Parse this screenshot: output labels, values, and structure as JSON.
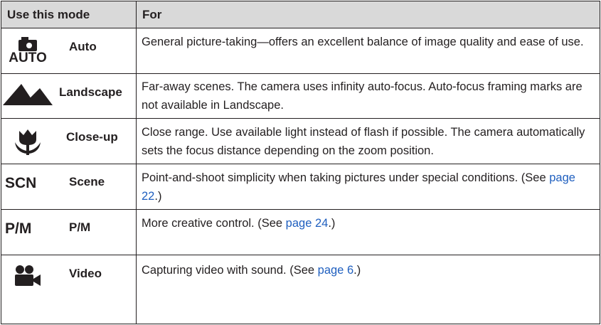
{
  "header": {
    "col_mode": "Use this mode",
    "col_for": "For"
  },
  "rows": [
    {
      "icon": "camera-auto-icon",
      "icon_text": "AUTO",
      "name": "Auto",
      "desc": "General picture-taking—offers an excellent balance of image quality and ease of use."
    },
    {
      "icon": "mountains-icon",
      "name": "Landscape",
      "desc": "Far-away scenes. The camera uses infinity auto-focus. Auto-focus framing marks are not available in Landscape."
    },
    {
      "icon": "tulip-icon",
      "name": "Close-up",
      "desc": "Close range. Use available light instead of flash if possible. The camera automatically sets the focus distance depending on the zoom position."
    },
    {
      "icon": "scn-icon",
      "icon_text": "SCN",
      "name": "Scene",
      "desc_pre": "Point-and-shoot simplicity when taking pictures under special conditions. (See ",
      "link": "page 22",
      "desc_post": ".)"
    },
    {
      "icon": "pm-icon",
      "icon_text": "P/M",
      "name": "P/M",
      "desc_pre": "More creative control. (See ",
      "link": "page 24",
      "desc_post": ".)"
    },
    {
      "icon": "video-camera-icon",
      "name": "Video",
      "desc_pre": "Capturing video with sound. (See ",
      "link": "page 6",
      "desc_post": ".)"
    }
  ]
}
